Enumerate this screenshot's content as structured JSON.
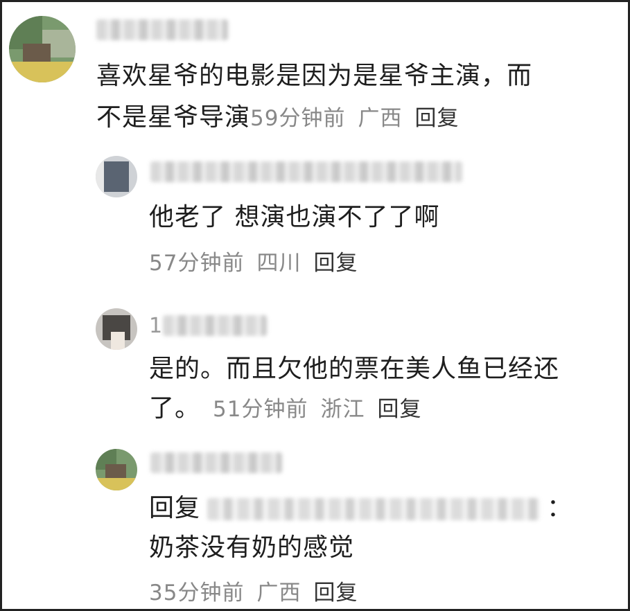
{
  "comments": [
    {
      "body_line1": "喜欢星爷的电影是因为是星爷主演，而",
      "body_line2": "不是星爷导演",
      "time": "59分钟前",
      "location": "广西",
      "reply_label": "回复"
    },
    {
      "body": "他老了 想演也演不了了啊",
      "time": "57分钟前",
      "location": "四川",
      "reply_label": "回复"
    },
    {
      "name_prefix": "1",
      "body_line1": "是的。而且欠他的票在美人鱼已经还",
      "body_line2": "了。",
      "time": "51分钟前",
      "location": "浙江",
      "reply_label": "回复"
    },
    {
      "reply_prefix": "回复",
      "reply_suffix": "：",
      "body": "奶茶没有奶的感觉",
      "time": "35分钟前",
      "location": "广西",
      "reply_label": "回复"
    }
  ],
  "colors": {
    "text": "#1e1e1e",
    "meta": "#888888",
    "border": "#222222"
  }
}
